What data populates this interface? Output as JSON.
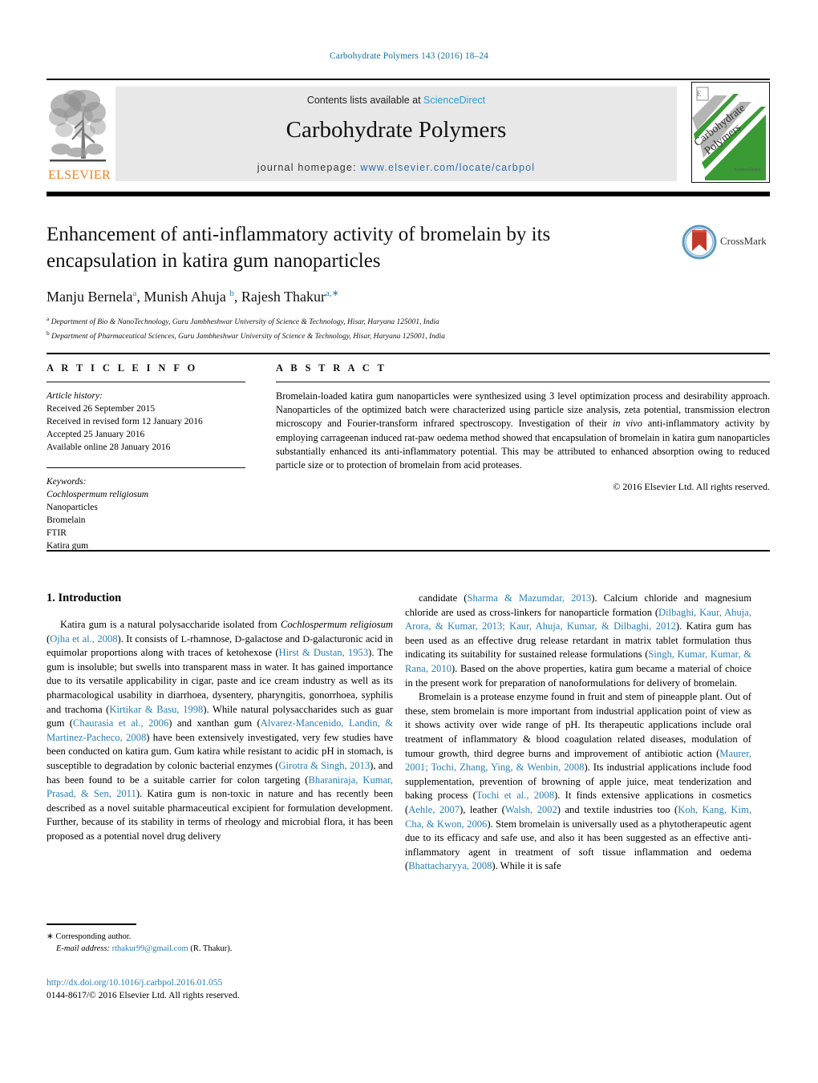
{
  "running_head": "Carbohydrate Polymers 143 (2016) 18–24",
  "masthead": {
    "contents_prefix": "Contents lists available at ",
    "sciencedirect": "ScienceDirect",
    "journal_title": "Carbohydrate Polymers",
    "homepage_label": "journal homepage: ",
    "homepage_url": "www.elsevier.com/locate/carbpol",
    "publisher_logo_text": "ELSEVIER",
    "cover_title_line1": "Carbohydrate",
    "cover_title_line2": "Polymers",
    "cover_footer": "ScienceDirect",
    "accent_link": "#2a9fd6",
    "accent_publisher": "#f47c20"
  },
  "article": {
    "title": "Enhancement of anti-inflammatory activity of bromelain by its encapsulation in katira gum nanoparticles",
    "authors_html": "Manju Bernela<sup>a</sup>, Munish Ahuja <sup>b</sup>, Rajesh Thakur<sup>a,∗</sup>",
    "affiliations": [
      "Department of Bio & NanoTechnology, Guru Jambheshwar University of Science & Technology, Hisar, Haryana 125001, India",
      "Department of Pharmaceutical Sciences, Guru Jambheshwar University of Science & Technology, Hisar, Haryana 125001, India"
    ],
    "affil_markers": [
      "a",
      "b"
    ],
    "crossmark_label": "CrossMark"
  },
  "article_info": {
    "heading": "A R T I C L E   I N F O",
    "history_label": "Article history:",
    "history": [
      "Received 26 September 2015",
      "Received in revised form 12 January 2016",
      "Accepted 25 January 2016",
      "Available online 28 January 2016"
    ],
    "keywords_label": "Keywords:",
    "keywords": [
      "Cochlospermum religiosum",
      "Nanoparticles",
      "Bromelain",
      "FTIR",
      "Katira gum"
    ],
    "keyword_italic_index": 0
  },
  "abstract": {
    "heading": "A B S T R A C T",
    "text_part1": "Bromelain-loaded katira gum nanoparticles were synthesized using 3 level optimization process and desirability approach. Nanoparticles of the optimized batch were characterized using particle size analysis, zeta potential, transmission electron microscopy and Fourier-transform infrared spectroscopy. Investigation of their ",
    "italic_phrase": "in vivo",
    "text_part2": " anti-inflammatory activity by employing carrageenan induced rat-paw oedema method showed that encapsulation of bromelain in katira gum nanoparticles substantially enhanced its anti-inflammatory potential. This may be attributed to enhanced absorption owing to reduced particle size or to protection of bromelain from acid proteases.",
    "copyright": "© 2016 Elsevier Ltd. All rights reserved."
  },
  "body": {
    "section_heading": "1.  Introduction",
    "left_paragraph_1_html": "Katira gum is a natural polysaccharide isolated from <i>Cochlospermum religiosum</i> (<span class=\"cite\">Ojha et al., 2008</span>). It consists of <span class=\"sc\">L</span>-rhamnose, <span class=\"sc\">D</span>-galactose and <span class=\"sc\">D</span>-galacturonic acid in equimolar proportions along with traces of ketohexose (<span class=\"cite\">Hirst &amp; Dustan, 1953</span>). The gum is insoluble; but swells into transparent mass in water. It has gained importance due to its versatile applicability in cigar, paste and ice cream industry as well as its pharmacological usability in diarrhoea, dysentery, pharyngitis, gonorrhoea, syphilis and trachoma (<span class=\"cite\">Kirtikar &amp; Basu, 1998</span>). While natural polysaccharides such as guar gum (<span class=\"cite\">Chaurasia et al., 2006</span>) and xanthan gum (<span class=\"cite\">Alvarez-Mancenido, Landin, &amp; Martinez-Pacheco, 2008</span>) have been extensively investigated, very few studies have been conducted on katira gum. Gum katira while resistant to acidic pH in stomach, is susceptible to degradation by colonic bacterial enzymes (<span class=\"cite\">Girotra &amp; Singh, 2013</span>), and has been found to be a suitable carrier for colon targeting (<span class=\"cite\">Bharaniraja, Kumar, Prasad, &amp; Sen, 2011</span>). Katira gum is non-toxic in nature and has recently been described as a novel suitable pharmaceutical excipient for formulation development. Further, because of its stability in terms of rheology and microbial flora, it has been proposed as a potential novel drug delivery",
    "right_paragraph_1_html": "candidate (<span class=\"cite\">Sharma &amp; Mazumdar, 2013</span>). Calcium chloride and magnesium chloride are used as cross-linkers for nanoparticle formation (<span class=\"cite\">Dilbaghi, Kaur, Ahuja, Arora, &amp; Kumar, 2013; Kaur, Ahuja, Kumar, &amp; Dilbaghi, 2012</span>). Katira gum has been used as an effective drug release retardant in matrix tablet formulation thus indicating its suitability for sustained release formulations (<span class=\"cite\">Singh, Kumar, Kumar, &amp; Rana, 2010</span>). Based on the above properties, katira gum became a material of choice in the present work for preparation of nanoformulations for delivery of bromelain.",
    "right_paragraph_2_html": "Bromelain is a protease enzyme found in fruit and stem of pineapple plant. Out of these, stem bromelain is more important from industrial application point of view as it shows activity over wide range of pH. Its therapeutic applications include oral treatment of inflammatory &amp; blood coagulation related diseases, modulation of tumour growth, third degree burns and improvement of antibiotic action (<span class=\"cite\">Maurer, 2001; Tochi, Zhang, Ying, &amp; Wenbin, 2008</span>). Its industrial applications include food supplementation, prevention of browning of apple juice, meat tenderization and baking process (<span class=\"cite\">Tochi et al., 2008</span>). It finds extensive applications in cosmetics (<span class=\"cite\">Aehle, 2007</span>), leather (<span class=\"cite\">Walsh, 2002</span>) and textile industries too (<span class=\"cite\">Koh, Kang, Kim, Cha, &amp; Kwon, 2006</span>). Stem bromelain is universally used as a phytotherapeutic agent due to its efficacy and safe use, and also it has been suggested as an effective anti-inflammatory agent in treatment of soft tissue inflammation and oedema (<span class=\"cite\">Bhattacharyya, 2008</span>). While it is safe"
  },
  "footnote": {
    "corresponding_marker": "∗",
    "corresponding_text": "Corresponding author.",
    "email_label": "E-mail address:",
    "email": "rthakur99@gmail.com",
    "email_suffix": "(R. Thakur).",
    "doi": "http://dx.doi.org/10.1016/j.carbpol.2016.01.055",
    "issn_line": "0144-8617/© 2016 Elsevier Ltd. All rights reserved."
  }
}
